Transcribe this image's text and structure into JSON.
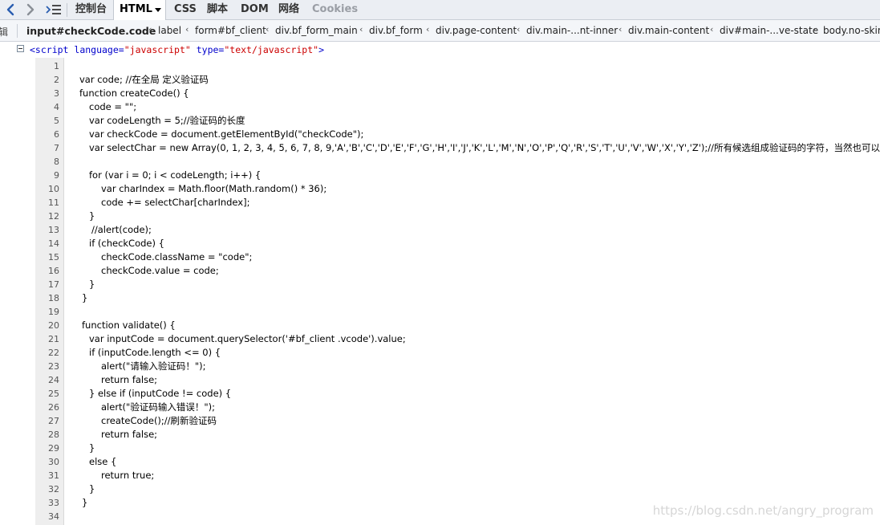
{
  "toolbar": {
    "tabs": [
      {
        "label": "控制台"
      },
      {
        "label": "HTML"
      },
      {
        "label": "CSS"
      },
      {
        "label": "脚本"
      },
      {
        "label": "DOM"
      },
      {
        "label": "网络"
      },
      {
        "label": "Cookies"
      }
    ]
  },
  "breadcrumb": {
    "edge_label": "辑",
    "items": [
      "input#checkCode.code",
      "label",
      "form#bf_client",
      "div.bf_form_main",
      "div.bf_form",
      "div.page-content",
      "div.main-...nt-inner",
      "div.main-content",
      "div#main-...ve-state",
      "body.no-skin"
    ]
  },
  "script_tag": {
    "open": "<script",
    "attr1": " language=",
    "val1": "\"javascript\"",
    "attr2": " type=",
    "val2": "\"text/javascript\"",
    "close": ">"
  },
  "code_lines": [
    "",
    "    var code; //在全局 定义验证码",
    "    function createCode() {",
    "        code = \"\";",
    "        var codeLength = 5;//验证码的长度",
    "        var checkCode = document.getElementById(\"checkCode\");",
    "        var selectChar = new Array(0, 1, 2, 3, 4, 5, 6, 7, 8, 9,'A','B','C','D','E','F','G','H','I','J','K','L','M','N','O','P','Q','R','S','T','U','V','W','X','Y','Z');//所有候选组成验证码的字符，当然也可以用中文的",
    "",
    "        for (var i = 0; i < codeLength; i++) {",
    "             var charIndex = Math.floor(Math.random() * 36);",
    "             code += selectChar[charIndex];",
    "        }",
    "         //alert(code);",
    "        if (checkCode) {",
    "             checkCode.className = \"code\";",
    "             checkCode.value = code;",
    "        }",
    "     }",
    "",
    "     function validate() {",
    "        var inputCode = document.querySelector('#bf_client .vcode').value;",
    "        if (inputCode.length <= 0) {",
    "             alert(\"请输入验证码！\");",
    "             return false;",
    "        } else if (inputCode != code) {",
    "             alert(\"验证码输入错误！\");",
    "             createCode();//刷新验证码",
    "             return false;",
    "        }",
    "        else {",
    "             return true;",
    "        }",
    "     }",
    ""
  ],
  "line_numbers": [
    "1",
    "2",
    "3",
    "4",
    "5",
    "6",
    "7",
    "8",
    "9",
    "10",
    "11",
    "12",
    "13",
    "14",
    "15",
    "16",
    "17",
    "18",
    "19",
    "20",
    "21",
    "22",
    "23",
    "24",
    "25",
    "26",
    "27",
    "28",
    "29",
    "30",
    "31",
    "32",
    "33",
    "34"
  ],
  "watermark": "https://blog.csdn.net/angry_program"
}
